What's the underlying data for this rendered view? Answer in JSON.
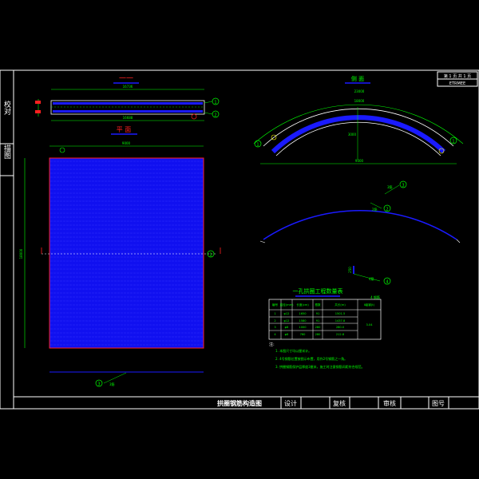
{
  "colors": {
    "background": "#000000",
    "frame": "#ffffff",
    "blue": "#1a1aff",
    "green": "#00ff00",
    "red": "#ff2020",
    "cyan": "#00ffff",
    "yellow": "#ffff00"
  },
  "left_strip": {
    "top_label": "校对",
    "bottom_label": "描图"
  },
  "top_right_box": {
    "line1": "第 1 页  共 1 页",
    "line2": "ETRMEE"
  },
  "views": {
    "section_label": "一一",
    "plan_label": "平 面",
    "side_label": "侧 面"
  },
  "dims": {
    "sect_top": "16736",
    "sect_bottom": "16688",
    "plan_top": "9000",
    "plan_side": "18000",
    "arc_top": "23000",
    "arc_inner": "18000",
    "arc_base": "9000",
    "arc_vert": "3000",
    "small_vert": "250"
  },
  "callouts": {
    "c1": "1",
    "c2": "2",
    "c3": "3",
    "c4": "4",
    "bar3_text": "3筋",
    "bar2_text": "2筋",
    "bar4_text": "4筋",
    "plan_bottom_text": "3筋"
  },
  "table": {
    "title": "一孔拱圈工程数量表",
    "note_top": "4 钢筋",
    "headers": [
      "编号",
      "直径(mm)",
      "长度(cm)",
      "根数",
      "共长(m)",
      "Ⅱ级钢(t)"
    ],
    "rows": [
      [
        "1",
        "φ12",
        "1650",
        "91",
        "1501.5",
        ""
      ],
      [
        "2",
        "φ12",
        "1580",
        "91",
        "1437.8",
        "3.04"
      ],
      [
        "3",
        "φ8",
        "1000",
        "280",
        "280.0",
        ""
      ],
      [
        "4",
        "φ8",
        "760",
        "280",
        "212.8",
        ""
      ]
    ]
  },
  "notes": {
    "heading": "注:",
    "n1": "1. 本图尺寸均以厘米计。",
    "n2": "2. 4号钢筋位置按图示布置，用作2号钢筋之一角。",
    "n3": "3. 拱圈钢筋保护层厚度3厘米，施工时注意钢筋间距符合规范。"
  },
  "title_block": {
    "drawing_title": "拱圈钢筋构造图",
    "design": "设计",
    "review": "复核",
    "approve": "审核",
    "drawing_no": "图号"
  }
}
